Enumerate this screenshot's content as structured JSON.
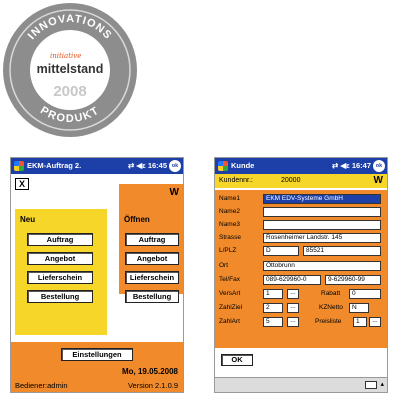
{
  "badge": {
    "top_text": "INNOVATIONS",
    "script_text": "initiative",
    "brand": "mittelstand",
    "year": "2008",
    "bottom_text": "PRODUKT"
  },
  "phone1": {
    "title": "EKM-Auftrag 2.",
    "time": "16:45",
    "ok": "ok",
    "close_label": "X",
    "corner_letter": "W",
    "neu": {
      "title": "Neu",
      "buttons": [
        "Auftrag",
        "Angebot",
        "Lieferschein",
        "Bestellung"
      ]
    },
    "oeffnen": {
      "title": "Öffnen",
      "buttons": [
        "Auftrag",
        "Angebot",
        "Lieferschein",
        "Bestellung"
      ]
    },
    "settings_label": "Einstellungen",
    "date": "Mo, 19.05.2008",
    "user": "Bediener:admin",
    "version": "Version 2.1.0.9"
  },
  "phone2": {
    "title": "Kunde",
    "time": "16:47",
    "ok": "ok",
    "kundennr_label": "Kundennr.:",
    "kundennr_value": "20000",
    "corner_letter": "W",
    "labels": {
      "name1": "Name1",
      "name2": "Name2",
      "name3": "Name3",
      "strasse": "Strasse",
      "lplz": "L/PLZ",
      "ort": "Ort",
      "telfax": "Tel/Fax",
      "versart": "VersArt",
      "rabatt": "Rabatt",
      "zahlziel": "ZahlZiel",
      "kznetto": "KZNetto",
      "zahlart": "ZahlArt",
      "preisliste": "Preisliste"
    },
    "values": {
      "name1": "EKM EDV-Systeme GmbH",
      "name2": "",
      "name3": "",
      "strasse": "Rosenheimer Landstr. 145",
      "land": "D",
      "plz": "85521",
      "ort": "Ottobrunn",
      "tel": "089-629960-0",
      "fax": "9-629960-99",
      "versart": "1",
      "rabatt": "0",
      "zahlziel": "2",
      "kznetto": "N",
      "zahlart": "5",
      "preisliste": "1"
    },
    "picker": "...",
    "ok_button": "OK"
  }
}
